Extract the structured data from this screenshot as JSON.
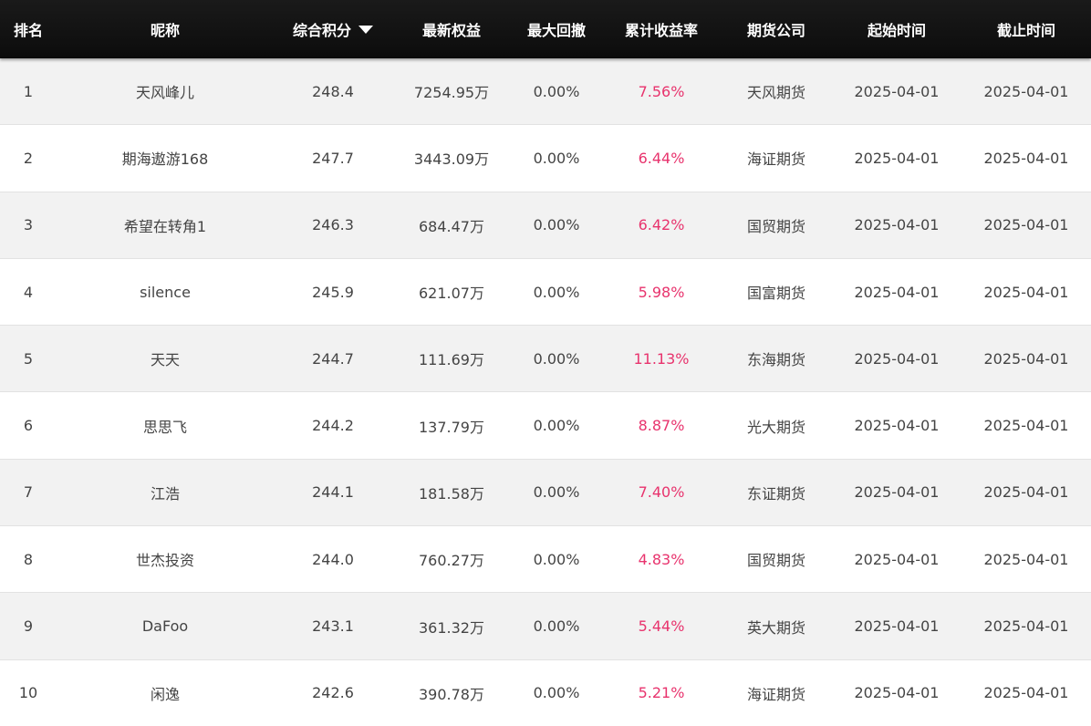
{
  "header": {
    "rank": "排名",
    "nickname": "昵称",
    "score": "综合积分",
    "equity": "最新权益",
    "drawdown": "最大回撤",
    "return": "累计收益率",
    "company": "期货公司",
    "start": "起始时间",
    "end": "截止时间",
    "sort_icon": "caret-down-icon"
  },
  "colors": {
    "header_bg": "#111111",
    "rate": "#e8336d",
    "row_odd": "#f2f2f2",
    "row_even": "#ffffff"
  },
  "rows": [
    {
      "rank": "1",
      "nickname": "天风峰儿",
      "score": "248.4",
      "equity": "7254.95万",
      "drawdown": "0.00%",
      "return": "7.56%",
      "company": "天风期货",
      "start": "2025-04-01",
      "end": "2025-04-01"
    },
    {
      "rank": "2",
      "nickname": "期海遨游168",
      "score": "247.7",
      "equity": "3443.09万",
      "drawdown": "0.00%",
      "return": "6.44%",
      "company": "海证期货",
      "start": "2025-04-01",
      "end": "2025-04-01"
    },
    {
      "rank": "3",
      "nickname": "希望在转角1",
      "score": "246.3",
      "equity": "684.47万",
      "drawdown": "0.00%",
      "return": "6.42%",
      "company": "国贸期货",
      "start": "2025-04-01",
      "end": "2025-04-01"
    },
    {
      "rank": "4",
      "nickname": "silence",
      "score": "245.9",
      "equity": "621.07万",
      "drawdown": "0.00%",
      "return": "5.98%",
      "company": "国富期货",
      "start": "2025-04-01",
      "end": "2025-04-01"
    },
    {
      "rank": "5",
      "nickname": "天天",
      "score": "244.7",
      "equity": "111.69万",
      "drawdown": "0.00%",
      "return": "11.13%",
      "company": "东海期货",
      "start": "2025-04-01",
      "end": "2025-04-01"
    },
    {
      "rank": "6",
      "nickname": "思思飞",
      "score": "244.2",
      "equity": "137.79万",
      "drawdown": "0.00%",
      "return": "8.87%",
      "company": "光大期货",
      "start": "2025-04-01",
      "end": "2025-04-01"
    },
    {
      "rank": "7",
      "nickname": "江浩",
      "score": "244.1",
      "equity": "181.58万",
      "drawdown": "0.00%",
      "return": "7.40%",
      "company": "东证期货",
      "start": "2025-04-01",
      "end": "2025-04-01"
    },
    {
      "rank": "8",
      "nickname": "世杰投资",
      "score": "244.0",
      "equity": "760.27万",
      "drawdown": "0.00%",
      "return": "4.83%",
      "company": "国贸期货",
      "start": "2025-04-01",
      "end": "2025-04-01"
    },
    {
      "rank": "9",
      "nickname": "DaFoo",
      "score": "243.1",
      "equity": "361.32万",
      "drawdown": "0.00%",
      "return": "5.44%",
      "company": "英大期货",
      "start": "2025-04-01",
      "end": "2025-04-01"
    },
    {
      "rank": "10",
      "nickname": "闲逸",
      "score": "242.6",
      "equity": "390.78万",
      "drawdown": "0.00%",
      "return": "5.21%",
      "company": "海证期货",
      "start": "2025-04-01",
      "end": "2025-04-01"
    }
  ]
}
